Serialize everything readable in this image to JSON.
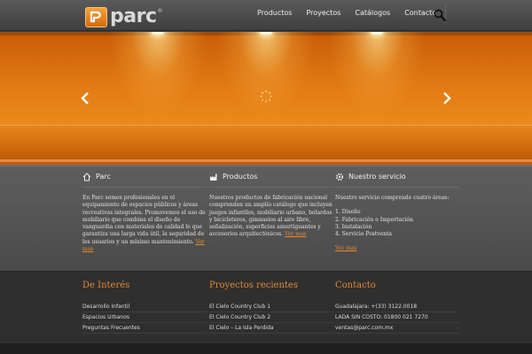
{
  "brand": {
    "name": "parc",
    "registered": "®"
  },
  "nav": {
    "items": [
      "Productos",
      "Proyectos",
      "Catálogos",
      "Contacto"
    ]
  },
  "colors": {
    "accent": "#e17a13",
    "footer_title": "#df8a34",
    "link": "#e98a2c"
  },
  "sections": [
    {
      "title": "Parc",
      "icon": "home-icon",
      "text": "En Parc somos profesionales en el equipamiento de espacios públicos y áreas recreativas integrales. Promovemos el uso de mobiliario que combina el diseño de vanguardia con materiales de calidad lo que garantiza una larga vida útil, la seguridad de los usuarios y un mínimo mantenimiento.",
      "more": "Ver mas"
    },
    {
      "title": "Productos",
      "icon": "factory-icon",
      "text": "Nuestros productos de fabricación nacional comprenden un amplio catálogo que incluyen juegos infantiles, mobiliario urbano, bolardos y bicicleteros, gimnasios al aire libre, señalización, superficies amortiguantes y accesorios arquitectónicos.",
      "more": "Ver mas"
    },
    {
      "title": "Nuestro servicio",
      "icon": "gear-icon",
      "intro": "Nuestro servicio comprende cuatro áreas:",
      "list": [
        "1. Diseño",
        "2. Fabricación o Importación",
        "3. Instalación",
        "4. Servicio Postventa"
      ],
      "more": "Ver mas"
    }
  ],
  "footer": {
    "interes": {
      "title": "De Interés",
      "items": [
        "Desarrollo Infantil",
        "Espacios Urbanos",
        "Preguntas Frecuentes"
      ]
    },
    "proyectos": {
      "title": "Proyectos recientes",
      "items": [
        "El Cielo Country Club 1",
        "El Cielo Country Club 2",
        "El Cielo – La Isla Perdida"
      ]
    },
    "contacto": {
      "title": "Contacto",
      "items": [
        "Guadalajara: +(33) 3122.0018",
        "LADA SIN COSTO: 01800 021 7270",
        "ventas@parc.com.mx"
      ]
    }
  }
}
